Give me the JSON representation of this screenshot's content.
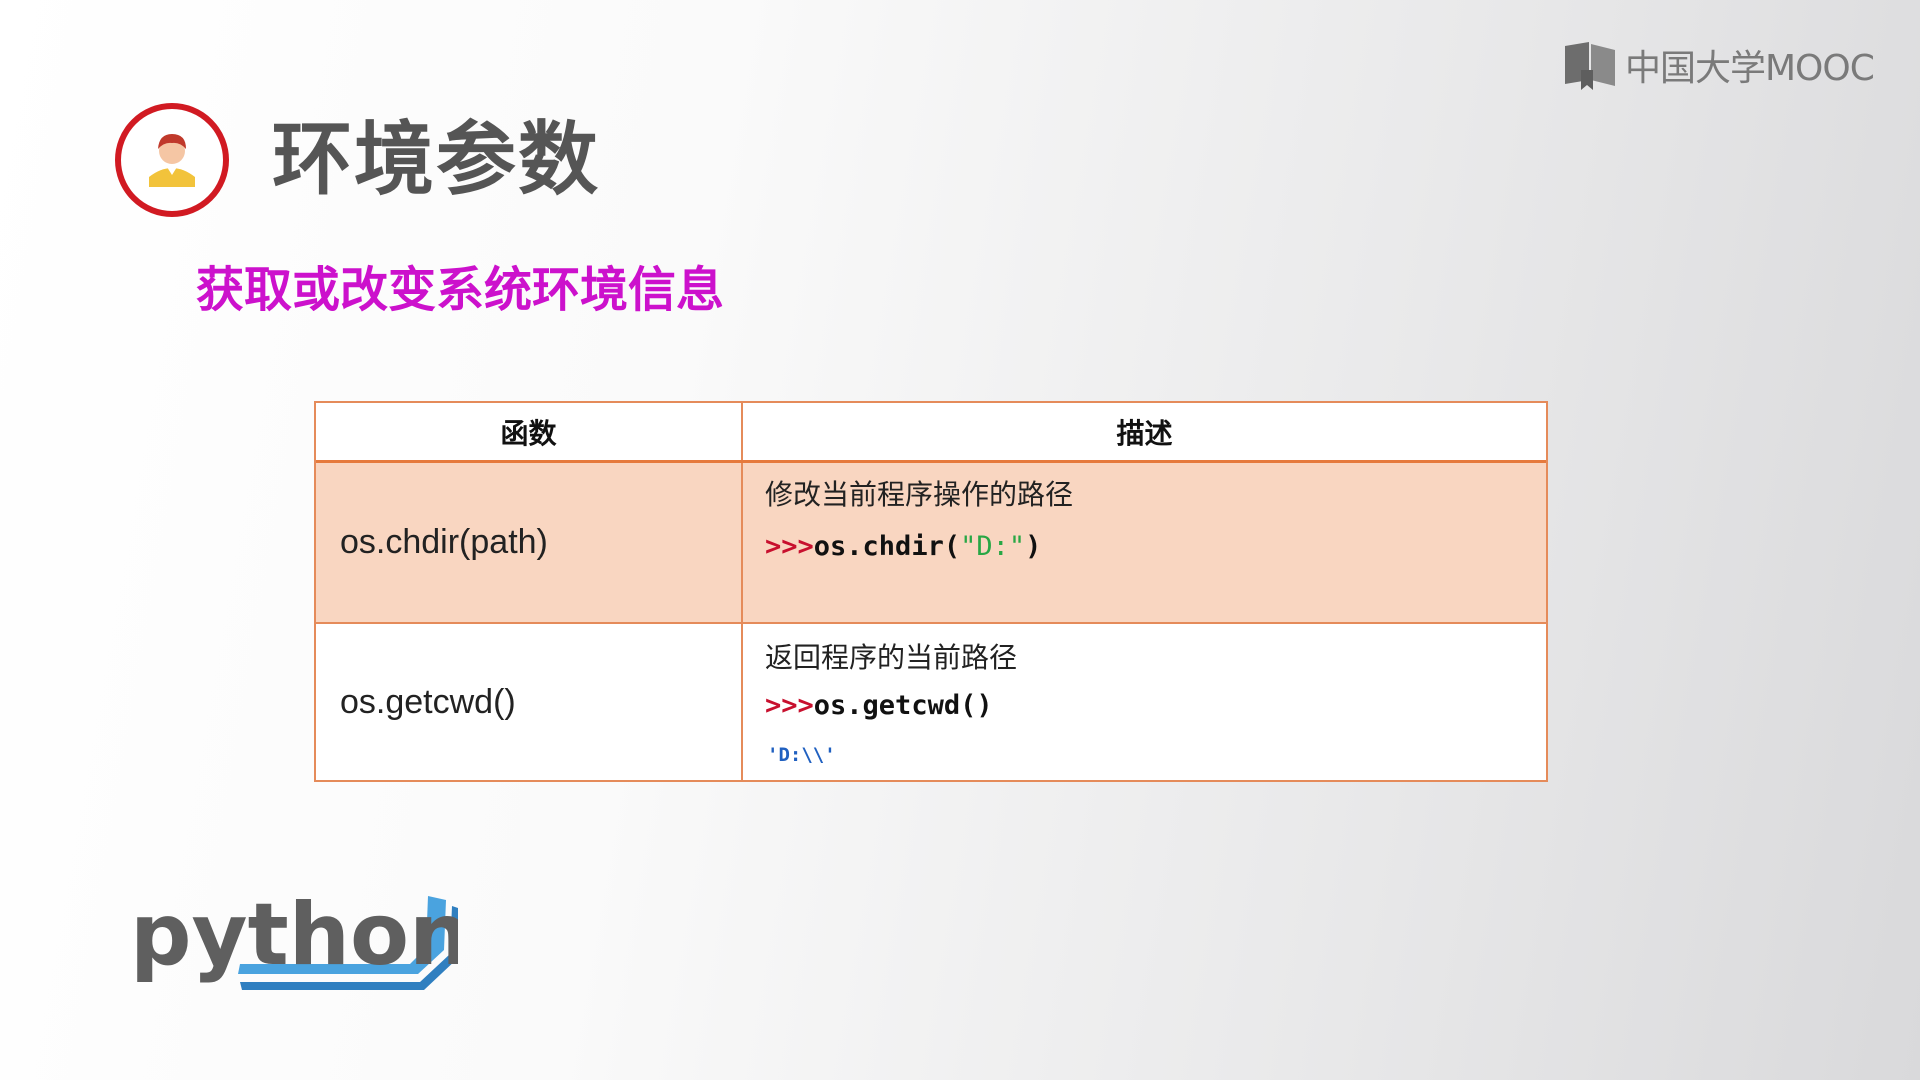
{
  "brand": {
    "text": "中国大学MOOC",
    "icon": "mooc-book-icon"
  },
  "title": {
    "text": "环境参数",
    "icon": "user-avatar-icon"
  },
  "subtitle": "获取或改变系统环境信息",
  "table": {
    "headers": [
      "函数",
      "描述"
    ],
    "rows": [
      {
        "function": "os.chdir(path)",
        "description": "修改当前程序操作的路径",
        "code_prompt": ">>>",
        "code_before": "os.chdir(",
        "code_string": "\"D:\"",
        "code_after": ")",
        "output": ""
      },
      {
        "function": "os.getcwd()",
        "description": "返回程序的当前路径",
        "code_prompt": ">>>",
        "code_before": "os.getcwd()",
        "code_string": "",
        "code_after": "",
        "output": "'D:\\\\'"
      }
    ]
  },
  "logo": {
    "text": "python",
    "icon": "python-logo"
  },
  "colors": {
    "title": "#555555",
    "subtitle": "#cc11cc",
    "table_border": "#e58b5a",
    "highlight_row": "#f9d6c1",
    "prompt": "#c8102e",
    "string": "#28a745",
    "output": "#2060c0"
  }
}
